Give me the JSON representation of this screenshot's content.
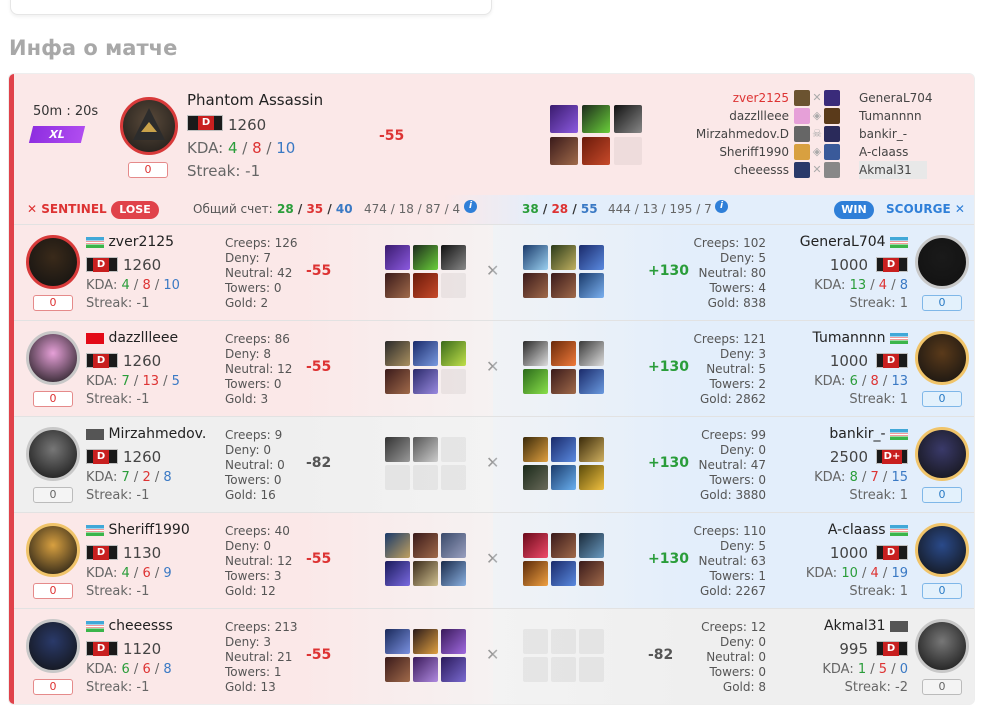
{
  "section_title": "Инфа о матче",
  "summary": {
    "time": "50m : 20s",
    "badge": "XL",
    "hero": "Phantom Assassin",
    "rank_letter": "D",
    "mmr": "1260",
    "kda_label": "KDA:",
    "kda": {
      "k": "4",
      "d": "8",
      "a": "10"
    },
    "streak": "Streak: -1",
    "delta": "-55",
    "zero": "0",
    "left_players": [
      "zver2125",
      "dazzllleee",
      "Mirzahmedov.D",
      "Sheriff1990",
      "cheeesss"
    ],
    "right_players": [
      "GeneraL704",
      "Tumannnn",
      "bankir_-",
      "A-claass",
      "Akmal31"
    ]
  },
  "teambar": {
    "sentinel": "SENTINEL",
    "lose": "LOSE",
    "total_label": "Общий счет:",
    "left_score": {
      "k": "28",
      "d": "35",
      "a": "40"
    },
    "left_extra": "474 / 18 / 87 / 4",
    "right_score": {
      "k": "38",
      "d": "28",
      "a": "55"
    },
    "right_extra": "444 / 13 / 195 / 7",
    "win": "WIN",
    "scourge": "SCOURGE"
  },
  "labels": {
    "kda": "KDA:",
    "creeps": "Creeps:",
    "deny": "Deny:",
    "neutral": "Neutral:",
    "towers": "Towers:",
    "gold": "Gold:"
  },
  "rows": [
    {
      "left": {
        "name": "zver2125",
        "flag": "uz",
        "rank": "D",
        "mmr": "1260",
        "k": "4",
        "d": "8",
        "a": "10",
        "streak": "Streak: -1",
        "zero": "0",
        "creeps": "126",
        "deny": "7",
        "neutral": "42",
        "towers": "0",
        "gold": "2",
        "delta": "-55"
      },
      "right": {
        "name": "GeneraL704",
        "flag": "uz",
        "rank": "D",
        "mmr": "1000",
        "k": "13",
        "d": "4",
        "a": "8",
        "streak": "Streak: 1",
        "zero": "0",
        "creeps": "102",
        "deny": "5",
        "neutral": "80",
        "towers": "4",
        "gold": "838",
        "delta": "+130"
      }
    },
    {
      "left": {
        "name": "dazzllleee",
        "flag": "tr",
        "rank": "D",
        "mmr": "1260",
        "k": "7",
        "d": "13",
        "a": "5",
        "streak": "Streak: -1",
        "zero": "0",
        "creeps": "86",
        "deny": "8",
        "neutral": "12",
        "towers": "0",
        "gold": "3",
        "delta": "-55"
      },
      "right": {
        "name": "Tumannnn",
        "flag": "uz",
        "rank": "D",
        "mmr": "1000",
        "k": "6",
        "d": "8",
        "a": "13",
        "streak": "Streak: 1",
        "zero": "0",
        "creeps": "121",
        "deny": "3",
        "neutral": "5",
        "towers": "2",
        "gold": "2862",
        "delta": "+130"
      }
    },
    {
      "left": {
        "name": "Mirzahmedov.",
        "flag": "gr",
        "rank": "D",
        "mmr": "1260",
        "k": "7",
        "d": "2",
        "a": "8",
        "streak": "Streak: -1",
        "zero": "0",
        "creeps": "9",
        "deny": "0",
        "neutral": "0",
        "towers": "0",
        "gold": "16",
        "delta": "-82"
      },
      "right": {
        "name": "bankir_-",
        "flag": "uz",
        "rank": "D+",
        "mmr": "2500",
        "k": "8",
        "d": "7",
        "a": "15",
        "streak": "Streak: 1",
        "zero": "0",
        "creeps": "99",
        "deny": "0",
        "neutral": "47",
        "towers": "0",
        "gold": "3880",
        "delta": "+130"
      }
    },
    {
      "left": {
        "name": "Sheriff1990",
        "flag": "uz",
        "rank": "D",
        "mmr": "1130",
        "k": "4",
        "d": "6",
        "a": "9",
        "streak": "Streak: -1",
        "zero": "0",
        "creeps": "40",
        "deny": "0",
        "neutral": "12",
        "towers": "3",
        "gold": "12",
        "delta": "-55"
      },
      "right": {
        "name": "A-claass",
        "flag": "uz",
        "rank": "D",
        "mmr": "1000",
        "k": "10",
        "d": "4",
        "a": "19",
        "streak": "Streak: 1",
        "zero": "0",
        "creeps": "110",
        "deny": "5",
        "neutral": "63",
        "towers": "1",
        "gold": "2267",
        "delta": "+130"
      }
    },
    {
      "left": {
        "name": "cheeesss",
        "flag": "uz",
        "rank": "D",
        "mmr": "1120",
        "k": "6",
        "d": "6",
        "a": "8",
        "streak": "Streak: -1",
        "zero": "0",
        "creeps": "213",
        "deny": "3",
        "neutral": "21",
        "towers": "1",
        "gold": "13",
        "delta": "-55"
      },
      "right": {
        "name": "Akmal31",
        "flag": "gr",
        "rank": "D",
        "mmr": "995",
        "k": "1",
        "d": "5",
        "a": "0",
        "streak": "Streak: -2",
        "zero": "0",
        "creeps": "12",
        "deny": "0",
        "neutral": "0",
        "towers": "0",
        "gold": "8",
        "delta": "-82"
      }
    }
  ],
  "colors": {
    "lose": "#e0424a",
    "win": "#2f7fd8",
    "positive": "#2a9d3a",
    "negative": "#d33333"
  }
}
